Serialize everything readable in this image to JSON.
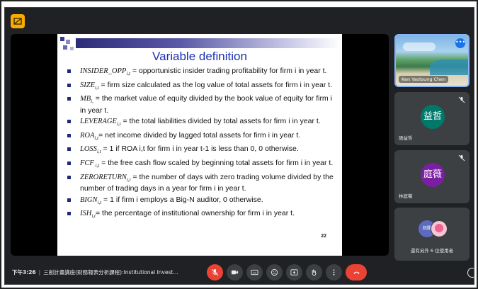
{
  "meeting": {
    "time": "下午3:26",
    "separator": "|",
    "title": "三創計畫講座(財務報表分析課程):Institutional Invest..."
  },
  "slide": {
    "title": "Variable definition",
    "page_number": "22",
    "items": [
      {
        "symbol": "INSIDER_OPP",
        "sub": "i,t",
        "text": " = opportunistic insider trading profitability for firm i in year t."
      },
      {
        "symbol": "SIZE",
        "sub": "i,t",
        "text": " = firm size calculated as the log value of total assets for firm i in year t."
      },
      {
        "symbol": "MB",
        "sub": "i,",
        "text": " = the market value of equity divided by the book value of equity for firm i in year t."
      },
      {
        "symbol": "LEVERAGE",
        "sub": "i,t",
        "text": " = the total liabilities divided by total assets for firm i in year t."
      },
      {
        "symbol": "ROA",
        "sub": "i,t",
        "text": "= net income divided by lagged total assets for firm i in year t."
      },
      {
        "symbol": "LOSS",
        "sub": "i,t",
        "text": " = 1 if ROA i,t for firm i in year t-1 is less than 0, 0 otherwise."
      },
      {
        "symbol": "FCF",
        "sub": " i,t",
        "text": " = the free cash flow scaled by beginning total assets for firm i in year t."
      },
      {
        "symbol": "ZERORETURN",
        "sub": "i,t",
        "text": " = the number of days with zero trading volume divided by the number of trading days in a year for firm i in year t."
      },
      {
        "symbol": "BIGN",
        "sub": "i,t",
        "text": " = 1 if firm i employs a Big-N auditor, 0 otherwise."
      },
      {
        "symbol": "ISH",
        "sub": "i,t",
        "text": "= the percentage of institutional ownership for firm i in year t."
      }
    ]
  },
  "participants": {
    "presenter": {
      "name": "Ken Yaotsung Chen",
      "more_icon": "more-dots-icon"
    },
    "p1": {
      "initials": "益哲",
      "name": "張益哲",
      "color": "#00796b"
    },
    "p2": {
      "initials": "庭薇",
      "name": "林庭薇",
      "color": "#7b1fa2"
    },
    "others": {
      "avatar_text": "鈺聞",
      "label": "還有另外 6 位使用者"
    }
  },
  "controls": {
    "icons": [
      "mic-off-icon",
      "camera-icon",
      "captions-icon",
      "emoji-icon",
      "present-icon",
      "raise-hand-icon",
      "more-options-icon",
      "hang-up-icon"
    ]
  },
  "colors": {
    "accent_red": "#ea4335",
    "highlight_blue": "#8ab4f8",
    "app_badge": "#f9ab00",
    "background": "#202124"
  }
}
